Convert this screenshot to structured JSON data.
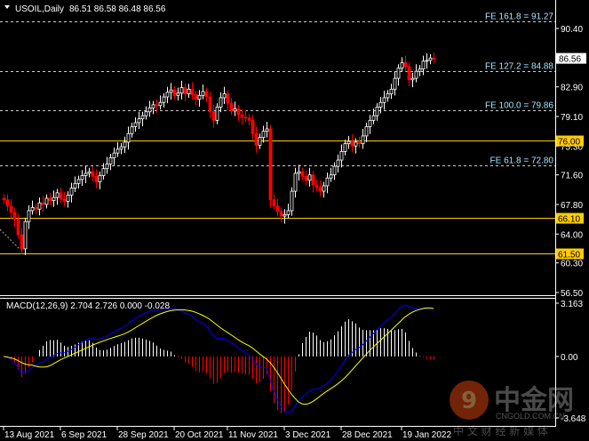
{
  "header": {
    "symbol": "USOIL,Daily",
    "ohlc": "86.51 86.58 86.48 86.56"
  },
  "colors": {
    "bull": "#ffffff",
    "bear": "#ff0000",
    "level": "#ffcc00",
    "fib": "#a0e8ff",
    "macd_line": "#0000ff",
    "signal_line": "#ffff00",
    "axis": "#ffffff"
  },
  "price_axis": {
    "ticks": [
      "90.40",
      "82.90",
      "79.10",
      "75.30",
      "71.60",
      "67.80",
      "64.00",
      "60.30",
      "56.50"
    ],
    "current": "86.56"
  },
  "levels": [
    {
      "value": 76.0,
      "label": "76.00"
    },
    {
      "value": 66.1,
      "label": "66.10"
    },
    {
      "value": 61.5,
      "label": "61.50"
    }
  ],
  "fib_levels": [
    {
      "value": 91.27,
      "label": "FE 161.8 = 91.27"
    },
    {
      "value": 84.88,
      "label": "FE 127.2 = 84.88"
    },
    {
      "value": 79.86,
      "label": "FE 100.0 = 79.86"
    },
    {
      "value": 72.8,
      "label": "FE 61.8 = 72.80"
    }
  ],
  "chart_data": {
    "type": "candlestick",
    "timeframe": "Daily",
    "ylim": [
      56.5,
      90.4
    ],
    "x_tick_labels": [
      "13 Aug 2021",
      "6 Sep 2021",
      "28 Sep 2021",
      "20 Oct 2021",
      "11 Nov 2021",
      "3 Dec 2021",
      "28 Dec 2021",
      "19 Jan 2022"
    ],
    "closes": [
      68.4,
      67.6,
      66.8,
      65.9,
      63.9,
      62.1,
      65.6,
      67.0,
      67.4,
      67.2,
      68.0,
      67.8,
      68.6,
      68.3,
      68.7,
      69.3,
      68.5,
      68.2,
      69.0,
      69.9,
      70.5,
      71.0,
      71.5,
      71.8,
      72.0,
      71.4,
      70.7,
      71.5,
      72.4,
      73.0,
      73.8,
      74.4,
      74.9,
      75.2,
      75.8,
      76.9,
      77.8,
      78.3,
      78.8,
      79.2,
      79.7,
      80.2,
      80.6,
      80.5,
      80.9,
      81.6,
      82.2,
      82.5,
      81.8,
      82.1,
      82.8,
      82.0,
      82.6,
      81.9,
      81.3,
      81.8,
      82.3,
      81.6,
      79.7,
      78.6,
      80.3,
      81.5,
      82.0,
      80.8,
      79.8,
      80.1,
      79.3,
      79.0,
      78.9,
      78.6,
      76.9,
      75.4,
      76.4,
      77.2,
      77.5,
      68.4,
      67.6,
      66.9,
      66.3,
      66.5,
      67.0,
      69.5,
      71.8,
      72.0,
      71.4,
      70.9,
      71.6,
      70.3,
      70.0,
      69.5,
      70.2,
      71.2,
      71.6,
      72.7,
      73.5,
      74.6,
      75.6,
      75.9,
      75.3,
      75.8,
      75.6,
      76.6,
      77.8,
      78.6,
      79.2,
      80.3,
      80.9,
      81.5,
      82.0,
      82.6,
      84.0,
      85.3,
      86.0,
      85.5,
      83.8,
      84.0,
      84.9,
      85.2,
      86.2,
      86.3,
      86.6,
      86.56
    ]
  },
  "macd": {
    "title": "MACD(12,26,9) 2.704 2.726 0.000 -0.028",
    "ylim": [
      -3.648,
      3.163
    ],
    "ticks": [
      "3.163",
      "0.00",
      "-3.648"
    ]
  },
  "watermark": {
    "brand": "中金网",
    "domain": "CNGOLD.COM.CN",
    "tagline": "中 文 财 经 新 媒 体"
  }
}
